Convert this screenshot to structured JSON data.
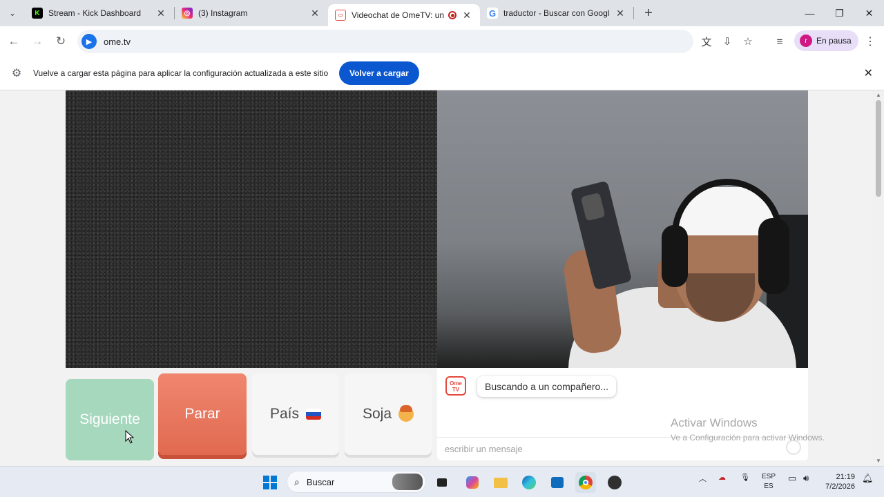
{
  "browser": {
    "tabs": [
      {
        "title": "Stream - Kick Dashboard",
        "icon": "kick-icon",
        "color": "#53fc18"
      },
      {
        "title": "(3) Instagram",
        "icon": "instagram-icon",
        "color": "#d62976"
      },
      {
        "title": "Videochat de OmeTV: una a",
        "icon": "ometv-icon",
        "color": "#e5473c",
        "active": true,
        "recording": true
      },
      {
        "title": "traductor - Buscar con Google",
        "icon": "google-icon",
        "color": "#4285f4"
      }
    ],
    "url": "ome.tv",
    "profile_label": "En pausa",
    "profile_initial": "r"
  },
  "infobar": {
    "message": "Vuelve a cargar esta página para aplicar la configuración actualizada a este sitio",
    "button_label": "Volver a cargar"
  },
  "controls": {
    "next_label": "Siguiente",
    "stop_label": "Parar",
    "country_label": "País",
    "gender_label": "Soja"
  },
  "chat": {
    "logo_text_top": "Ome",
    "logo_text_bottom": "TV",
    "status_message": "Buscando a un compañero...",
    "input_placeholder": "escribir un mensaje"
  },
  "watermark": {
    "title": "Activar Windows",
    "subtitle": "Ve a Configuración para activar Windows."
  },
  "taskbar": {
    "search_label": "Buscar",
    "language_top": "ESP",
    "language_bottom": "ES",
    "time": "21:19",
    "date": "7/2/2026"
  }
}
